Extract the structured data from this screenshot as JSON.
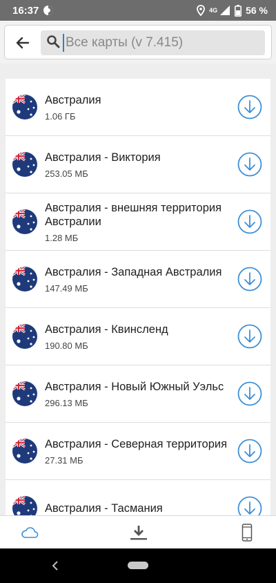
{
  "status_bar": {
    "time": "16:37",
    "network": "4G",
    "battery_text": "56 %"
  },
  "search": {
    "placeholder": "Все карты (v 7.415)",
    "value": ""
  },
  "maps": [
    {
      "title": "Австралия",
      "size": "1.06 ГБ"
    },
    {
      "title": "Австралия - Виктория",
      "size": "253.05 МБ"
    },
    {
      "title": "Австралия - внешняя территория Австралии",
      "size": "1.28 МБ"
    },
    {
      "title": "Австралия - Западная Австралия",
      "size": "147.49 МБ"
    },
    {
      "title": "Австралия - Квинсленд",
      "size": "190.80 МБ"
    },
    {
      "title": "Австралия - Новый Южный Уэльс",
      "size": "296.13 МБ"
    },
    {
      "title": "Австралия - Северная территория",
      "size": "27.31 МБ"
    },
    {
      "title": "Австралия - Тасмания",
      "size": ""
    }
  ],
  "colors": {
    "accent": "#3d8ed6",
    "status_bar": "#6d6d6d",
    "flag_blue": "#1f3a7a",
    "flag_red": "#d2263a"
  },
  "icons": {
    "flag": "australia-flag-icon",
    "download": "download-circle-icon",
    "nav_cloud": "cloud-icon",
    "nav_downloads": "download-tray-icon",
    "nav_device": "smartphone-icon"
  }
}
